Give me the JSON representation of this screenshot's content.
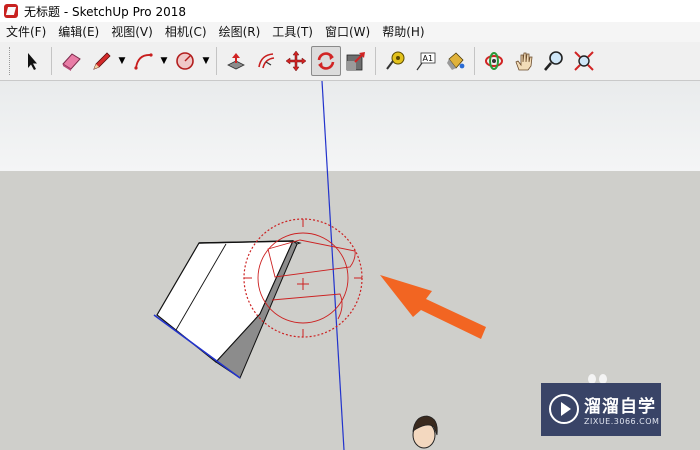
{
  "window": {
    "title": "无标题 - SketchUp Pro 2018"
  },
  "menu": {
    "items": [
      "文件(F)",
      "编辑(E)",
      "视图(V)",
      "相机(C)",
      "绘图(R)",
      "工具(T)",
      "窗口(W)",
      "帮助(H)"
    ]
  },
  "toolbar": {
    "tools": [
      {
        "icon": "select-arrow-icon"
      },
      {
        "icon": "eraser-icon"
      },
      {
        "icon": "pencil-line-icon"
      },
      {
        "icon": "arc-icon"
      },
      {
        "icon": "shape-circle-icon"
      },
      {
        "icon": "push-pull-icon"
      },
      {
        "icon": "offset-icon"
      },
      {
        "icon": "move-icon"
      },
      {
        "icon": "rotate-icon",
        "active": true
      },
      {
        "icon": "scale-icon"
      },
      {
        "icon": "tape-measure-icon"
      },
      {
        "icon": "text-icon",
        "label": "A1"
      },
      {
        "icon": "paint-bucket-icon"
      },
      {
        "icon": "orbit-icon"
      },
      {
        "icon": "pan-hand-icon"
      },
      {
        "icon": "zoom-icon"
      },
      {
        "icon": "zoom-extents-icon"
      }
    ]
  },
  "watermark": {
    "title": "溜溜自学",
    "subtitle": "ZIXUE.3066.COM"
  },
  "colors": {
    "rotate_accent": "#cc2222",
    "callout_arrow": "#f26522",
    "axis_blue": "#2233cc"
  }
}
